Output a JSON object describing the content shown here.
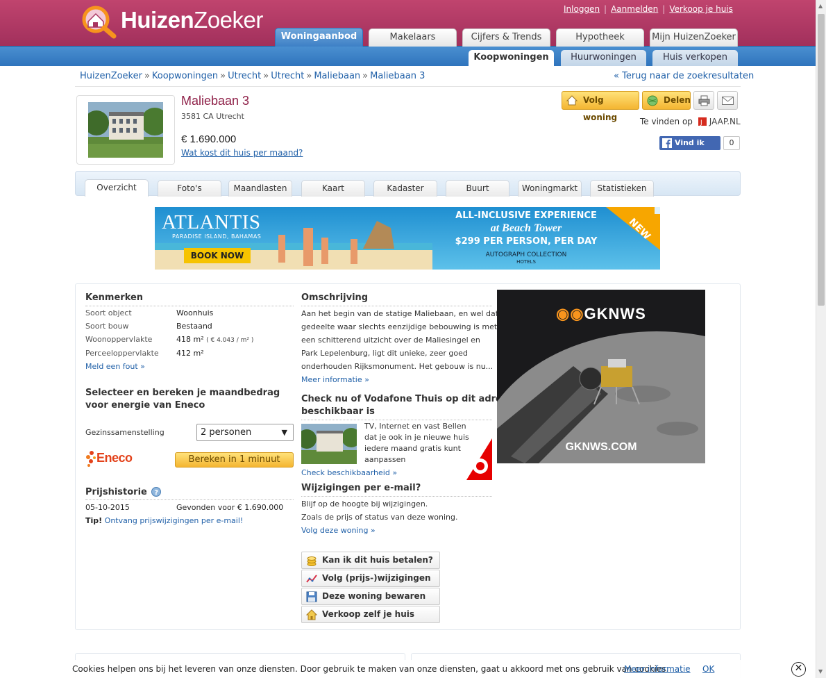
{
  "header": {
    "logo_text_bold": "Huizen",
    "logo_text_light": "Zoeker",
    "top_links": [
      "Inloggen",
      "Aanmelden",
      "Verkoop je huis"
    ],
    "main_tabs": [
      "Woningaanbod",
      "Makelaars",
      "Cijfers & Trends",
      "Hypotheek",
      "Mijn HuizenZoeker"
    ],
    "sub_tabs": [
      "Koopwoningen",
      "Huurwoningen",
      "Huis verkopen"
    ]
  },
  "breadcrumb": [
    "HuizenZoeker",
    "Koopwoningen",
    "Utrecht",
    "Utrecht",
    "Maliebaan",
    "Maliebaan 3"
  ],
  "back_link": "« Terug naar de zoekresultaten",
  "property": {
    "title": "Maliebaan 3",
    "zip_city": "3581 CA Utrecht",
    "price": "€ 1.690.000",
    "cost_link": "Wat kost dit huis per maand?"
  },
  "actions": {
    "follow": "Volg woning",
    "share": "Delen",
    "found_on": "Te vinden op",
    "found_site": "JAAP.NL",
    "fb_like": "Vind ik leuk",
    "fb_count": "0"
  },
  "detail_tabs": [
    "Overzicht",
    "Foto's",
    "Maandlasten",
    "Kaart",
    "Kadaster",
    "Buurt",
    "Woningmarkt",
    "Statistieken"
  ],
  "banner": {
    "brand": "ATLANTIS",
    "location": "PARADISE ISLAND, BAHAMAS",
    "cta": "BOOK NOW",
    "line1": "ALL-INCLUSIVE EXPERIENCE",
    "line2": "at Beach Tower",
    "line3": "$299 PER PERSON, PER DAY",
    "line4": "AUTOGRAPH COLLECTION",
    "line5": "HOTELS",
    "tag": "NEW"
  },
  "kenmerken": {
    "title": "Kenmerken",
    "rows": [
      {
        "label": "Soort object",
        "value": "Woonhuis"
      },
      {
        "label": "Soort bouw",
        "value": "Bestaand"
      },
      {
        "label": "Woonoppervlakte",
        "value": "418 m²",
        "extra": "( € 4.043 / m² )"
      },
      {
        "label": "Perceeloppervlakte",
        "value": "412 m²"
      }
    ],
    "report_link": "Meld een fout »"
  },
  "energy": {
    "title_line1": "Selecteer en bereken je maandbedrag",
    "title_line2": "voor energie van Eneco",
    "household_label": "Gezinssamenstelling",
    "household_value": "2 personen",
    "logo_text": "Eneco",
    "calc_button": "Bereken in 1 minuut"
  },
  "price_history": {
    "title": "Prijshistorie",
    "date": "05-10-2015",
    "entry": "Gevonden voor € 1.690.000",
    "tip_prefix": "Tip!",
    "tip_link": "Ontvang prijswijzigingen per e-mail!"
  },
  "description": {
    "title": "Omschrijving",
    "lines": [
      "Aan het begin van de statige Maliebaan, en wel dat",
      "gedeelte waar slechts eenzijdige bebouwing is met",
      "een schitterend uitzicht over de Maliesingel en",
      "Park Lepelenburg, ligt dit unieke, zeer goed",
      "onderhouden Rijksmonument. Het gebouw is nu..."
    ],
    "more_link": "Meer informatie »"
  },
  "vodafone": {
    "title_line1": "Check nu of Vodafone Thuis op dit adres",
    "title_line2": "beschikbaar is",
    "lines": [
      "TV, Internet en vast Bellen",
      "dat je ook in je nieuwe huis",
      "iedere maand gratis kunt",
      "aanpassen"
    ],
    "link": "Check beschikbaarheid »"
  },
  "email_changes": {
    "title": "Wijzigingen per e-mail?",
    "line1": "Blijf op de hoogte bij wijzigingen.",
    "line2": "Zoals de prijs of status van deze woning.",
    "link": "Volg deze woning »"
  },
  "action_buttons": [
    "Kan ik dit huis betalen?",
    "Volg (prijs-)wijzigingen",
    "Deze woning bewaren",
    "Verkoop zelf je huis"
  ],
  "side_ad": {
    "logo": "GKNWS",
    "url": "GKNWS.COM"
  },
  "cookie_bar": {
    "text": "Cookies helpen ons bij het leveren van onze diensten. Door gebruik te maken van onze diensten, gaat u akkoord met ons gebruik van cookies.",
    "more": "Meer informatie",
    "ok": "OK"
  },
  "colors": {
    "brand": "#a83460",
    "nav_blue": "#3a7fc3",
    "link": "#2060a8",
    "button_yellow": "#f7c445"
  }
}
